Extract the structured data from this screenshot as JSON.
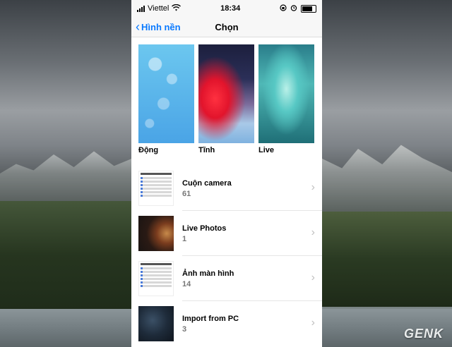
{
  "status_bar": {
    "carrier": "Viettel",
    "time": "18:34"
  },
  "nav": {
    "back_label": "Hình nền",
    "title": "Chọn"
  },
  "wallpapers": [
    {
      "label": "Động"
    },
    {
      "label": "Tĩnh"
    },
    {
      "label": "Live"
    }
  ],
  "albums": [
    {
      "name": "Cuộn camera",
      "count": "61"
    },
    {
      "name": "Live Photos",
      "count": "1"
    },
    {
      "name": "Ảnh màn hình",
      "count": "14"
    },
    {
      "name": "Import from PC",
      "count": "3"
    }
  ],
  "watermark": "GENK",
  "colors": {
    "accent": "#0a7aff"
  }
}
